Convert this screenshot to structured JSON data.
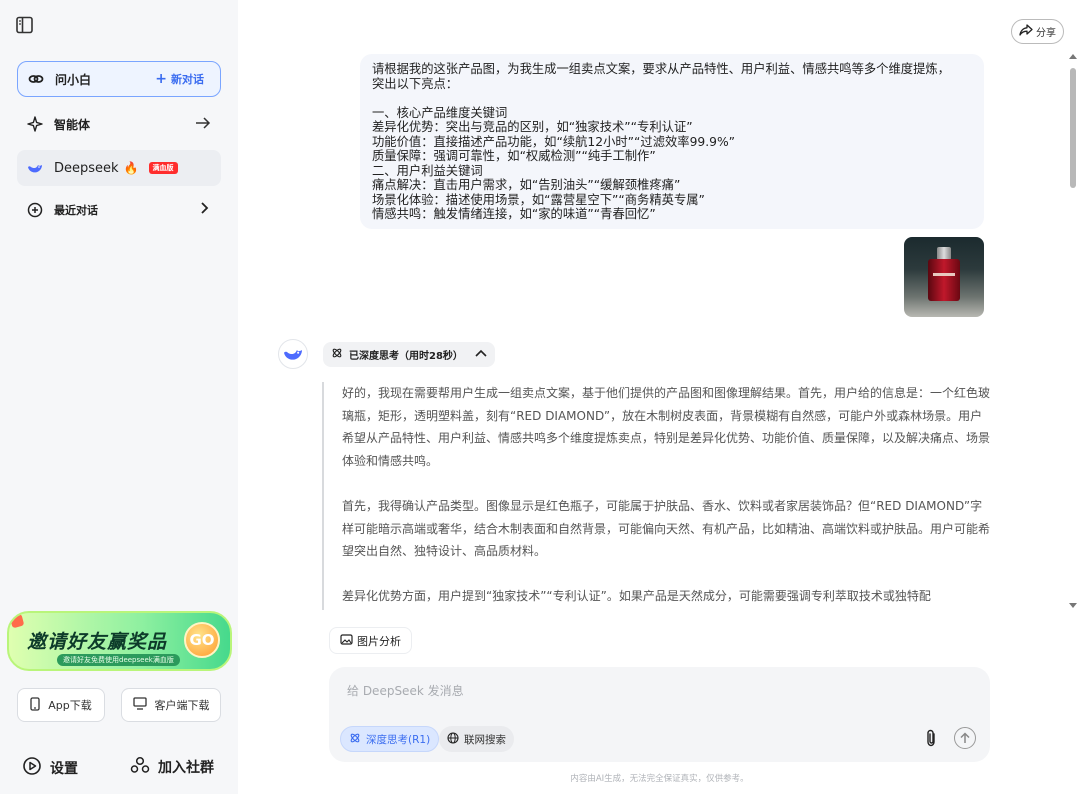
{
  "sidebar": {
    "active_item": {
      "label": "问小白",
      "new_chat": "新对话"
    },
    "agent": {
      "label": "智能体"
    },
    "deepseek": {
      "label": "Deepseek",
      "badge": "满血版"
    },
    "recent": {
      "label": "最近对话"
    },
    "banner": {
      "title": "邀请好友赢奖品",
      "subtitle": "邀请好友免费使用deepseek满血版",
      "go": "GO"
    },
    "app_download": "App下载",
    "client_download": "客户端下载",
    "settings": "设置",
    "community": "加入社群"
  },
  "header": {
    "share_label": "分享"
  },
  "chat": {
    "user_message": "请根据我的这张产品图，为我生成一组卖点文案，要求从产品特性、用户利益、情感共鸣等多个维度提炼，\n突出以下亮点：\n\n一、核心产品维度关键词\n差异化优势：突出与竞品的区别，如“独家技术”“专利认证”\n功能价值：直接描述产品功能，如“续航12小时”“过滤效率99.9%”\n质量保障：强调可靠性，如“权威检测”“纯手工制作”\n二、用户利益关键词\n痛点解决：直击用户需求，如“告别油头”“缓解颈椎疼痛”\n场景化体验：描述使用场景，如“露营星空下”“商务精英专属”\n情感共鸣：触发情绪连接，如“家的味道”“青春回忆”",
    "thinking_label": "已深度思考（用时28秒）",
    "thinking_paragraphs": [
      "好的，我现在需要帮用户生成一组卖点文案，基于他们提供的产品图和图像理解结果。首先，用户给的信息是：一个红色玻璃瓶，矩形，透明塑料盖，刻有“RED DIAMOND”，放在木制树皮表面，背景模糊有自然感，可能户外或森林场景。用户希望从产品特性、用户利益、情感共鸣多个维度提炼卖点，特别是差异化优势、功能价值、质量保障，以及解决痛点、场景体验和情感共鸣。",
      "首先，我得确认产品类型。图像显示是红色瓶子，可能属于护肤品、香水、饮料或者家居装饰品？但“RED DIAMOND”字样可能暗示高端或奢华，结合木制表面和自然背景，可能偏向天然、有机产品，比如精油、高端饮料或护肤品。用户可能希望突出自然、独特设计、高品质材料。",
      "差异化优势方面，用户提到“独家技术”“专利认证”。如果产品是天然成分，可能需要强调专利萃取技术或独特配"
    ],
    "image_analysis_label": "图片分析"
  },
  "composer": {
    "placeholder": "给 DeepSeek 发消息",
    "deep_think_label": "深度思考(R1)",
    "web_search_label": "联网搜索",
    "disclaimer": "内容由AI生成，无法完全保证真实，仅供参考。"
  },
  "colors": {
    "accent": "#3a6cf0",
    "badge_red": "#ff2d2d",
    "banner_green": "#8ef0a0"
  }
}
